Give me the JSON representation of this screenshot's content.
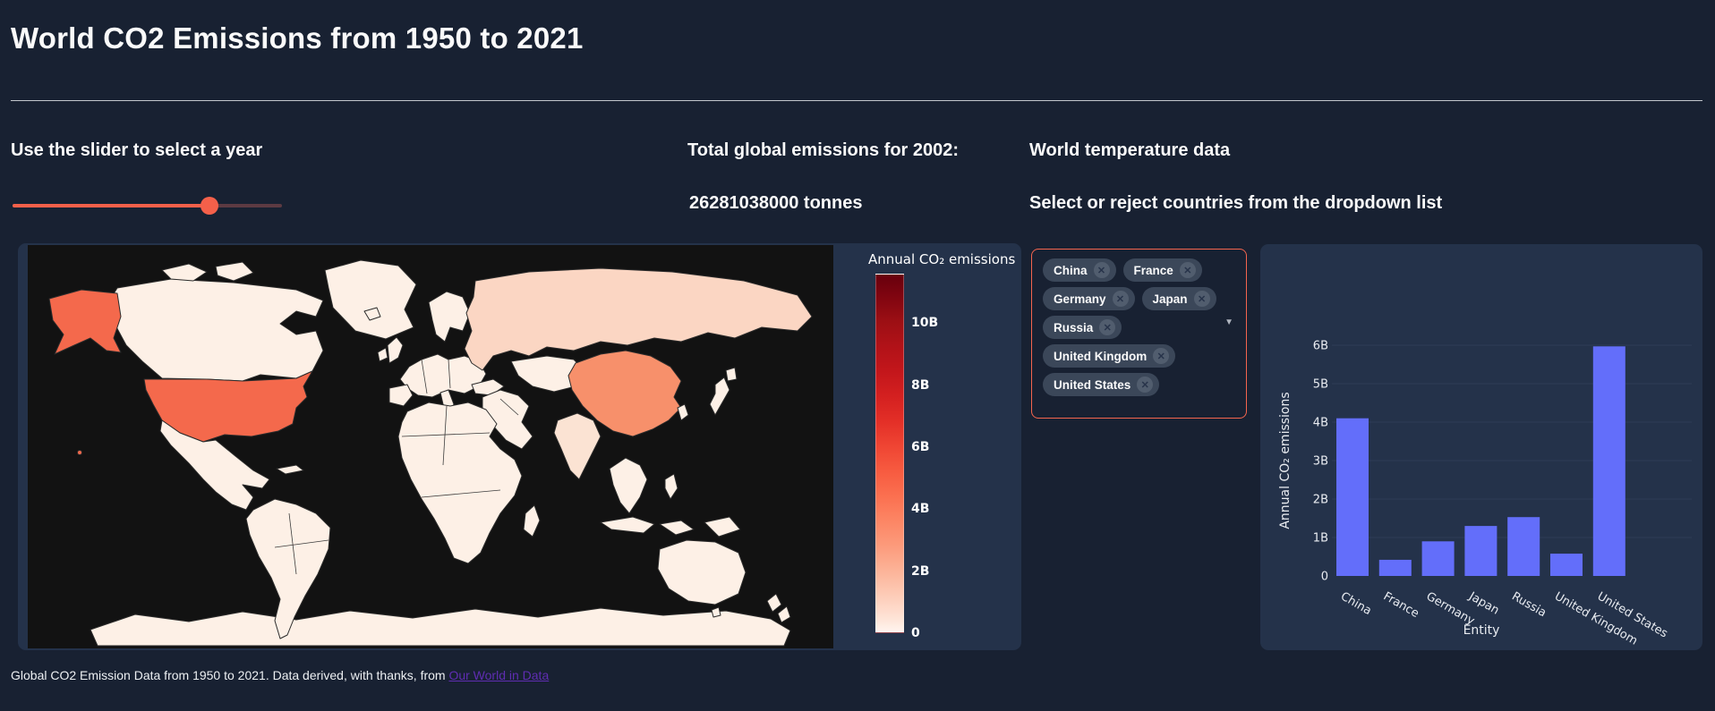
{
  "page": {
    "title": "World CO2 Emissions from 1950 to 2021",
    "footer_text": "Global CO2 Emission Data from 1950 to 2021. Data derived, with thanks, from ",
    "footer_link_text": "Our World in Data"
  },
  "slider_section": {
    "heading": "Use the slider to select a year",
    "min_year": 1950,
    "max_year": 2021,
    "selected_year": 2002,
    "percent": 73
  },
  "totals_section": {
    "heading": "Total global emissions for 2002:",
    "value_text": "26281038000 tonnes"
  },
  "temperature_section": {
    "heading": "World temperature data",
    "subheading": "Select or reject countries from the dropdown list",
    "selected_countries": [
      "China",
      "France",
      "Germany",
      "Japan",
      "Russia",
      "United Kingdom",
      "United States"
    ]
  },
  "map": {
    "type": "choropleth",
    "colorbar": {
      "title": "Annual CO₂ emissions",
      "vmax": 11.6,
      "ticks": [
        {
          "label": "10B",
          "value": 10
        },
        {
          "label": "8B",
          "value": 8
        },
        {
          "label": "6B",
          "value": 6
        },
        {
          "label": "4B",
          "value": 4
        },
        {
          "label": "2B",
          "value": 2
        },
        {
          "label": "0",
          "value": 0
        }
      ]
    },
    "highlighted_countries": [
      {
        "country": "United States",
        "approx_value_billions": 5.97
      },
      {
        "country": "China",
        "approx_value_billions": 4.1
      },
      {
        "country": "Russia",
        "approx_value_billions": 1.53
      },
      {
        "country": "India",
        "approx_value_billions": 1.0
      }
    ]
  },
  "chart_data": {
    "type": "bar",
    "categories": [
      "China",
      "France",
      "Germany",
      "Japan",
      "Russia",
      "United Kingdom",
      "United States"
    ],
    "values_billions": [
      4.1,
      0.42,
      0.9,
      1.3,
      1.53,
      0.58,
      5.97
    ],
    "xlabel": "Entity",
    "ylabel": "Annual CO₂ emissions",
    "yticks": [
      "0",
      "1B",
      "2B",
      "3B",
      "4B",
      "5B",
      "6B"
    ],
    "ylim": [
      0,
      6.5
    ],
    "bar_color": "#636efa",
    "legend": "none",
    "grid": "horizontal"
  },
  "icons": {
    "chip_remove": "✕",
    "dropdown_caret": "▼"
  },
  "colors": {
    "background": "#182132",
    "panel": "#24324a",
    "primary": "#f4604a",
    "bar": "#636efa",
    "link": "#5f2db2",
    "chip_bg": "#3b4759",
    "dropdown_border": "#f4654e",
    "map_ocean": "#121212",
    "country_default": "#fdf0e6",
    "country_us": "#f4694c",
    "country_china": "#f7906b",
    "country_russia": "#fbd6c3",
    "country_india": "#fbe3d3"
  }
}
